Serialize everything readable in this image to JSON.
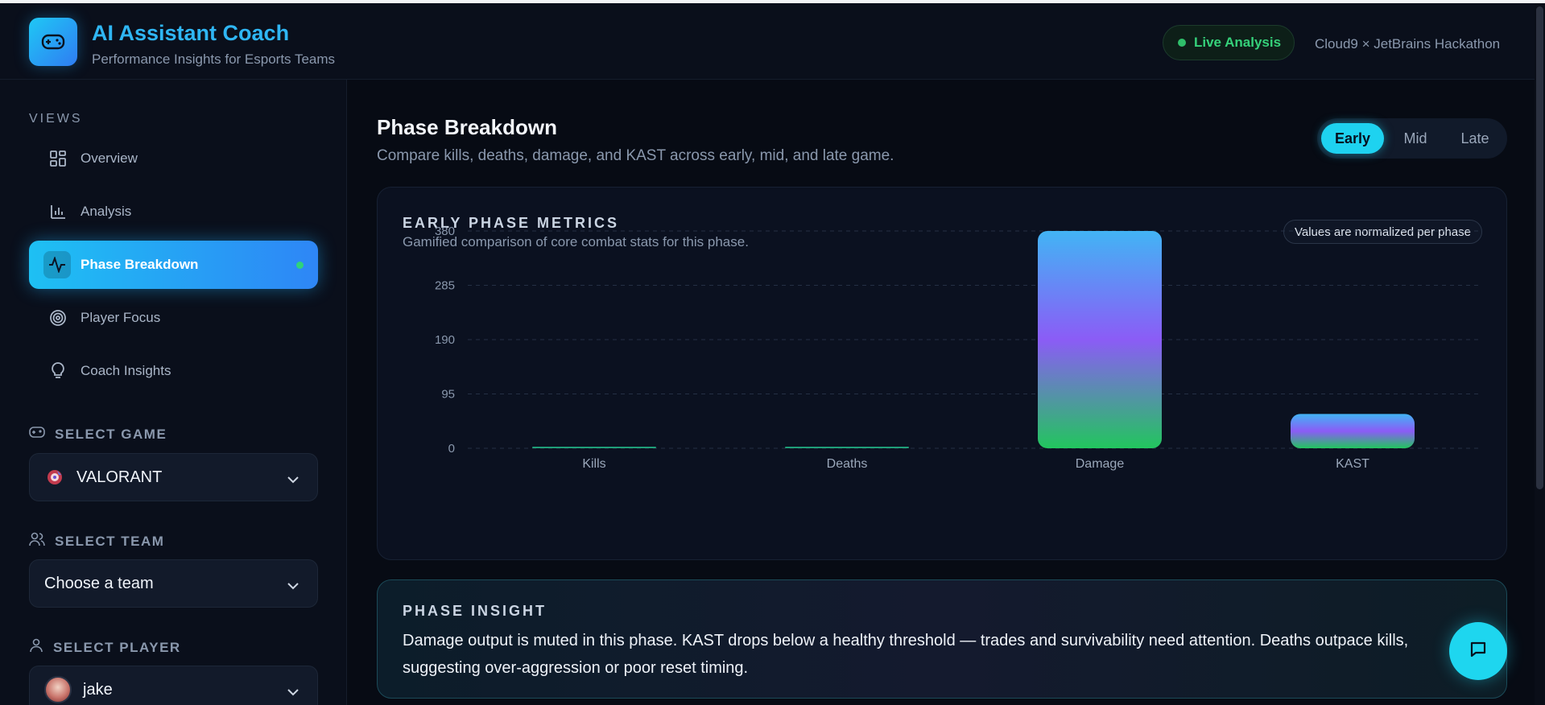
{
  "header": {
    "title": "AI Assistant Coach",
    "subtitle": "Performance Insights for Esports Teams",
    "live_label": "Live Analysis",
    "hackathon": "Cloud9 × JetBrains Hackathon"
  },
  "sidebar": {
    "views_title": "VIEWS",
    "items": [
      {
        "label": "Overview",
        "icon": "grid-icon"
      },
      {
        "label": "Analysis",
        "icon": "bar-chart-icon"
      },
      {
        "label": "Phase Breakdown",
        "icon": "activity-icon",
        "active": true
      },
      {
        "label": "Player Focus",
        "icon": "target-icon"
      },
      {
        "label": "Coach Insights",
        "icon": "lightbulb-icon"
      }
    ],
    "game": {
      "label": "SELECT GAME",
      "value": "VALORANT"
    },
    "team": {
      "label": "SELECT TEAM",
      "value": "Choose a team"
    },
    "player": {
      "label": "SELECT PLAYER",
      "value": "jake"
    }
  },
  "main": {
    "title": "Phase Breakdown",
    "subtitle": "Compare kills, deaths, damage, and KAST across early, mid, and late game.",
    "tabs": [
      {
        "label": "Early",
        "active": true
      },
      {
        "label": "Mid"
      },
      {
        "label": "Late"
      }
    ],
    "card": {
      "heading": "EARLY PHASE METRICS",
      "subheading": "Gamified comparison of core combat stats for this phase.",
      "pill": "Values are normalized per phase"
    },
    "insight": {
      "heading": "PHASE INSIGHT",
      "text": "Damage output is muted in this phase. KAST drops below a healthy threshold — trades and survivability need attention. Deaths outpace kills, suggesting over-aggression or poor reset timing."
    }
  },
  "colors": {
    "accent": "#1ec0f3",
    "live": "#35d17a",
    "bar_top": "#42b4f5",
    "bar_mid": "#8b5cf6",
    "bar_bottom": "#22c55e"
  },
  "chart_data": {
    "type": "bar",
    "categories": [
      "Kills",
      "Deaths",
      "Damage",
      "KAST"
    ],
    "values": [
      0.5,
      0.5,
      380,
      60
    ],
    "yticks": [
      0,
      95,
      190,
      285,
      380
    ],
    "ylim": [
      0,
      380
    ],
    "grid": true
  }
}
